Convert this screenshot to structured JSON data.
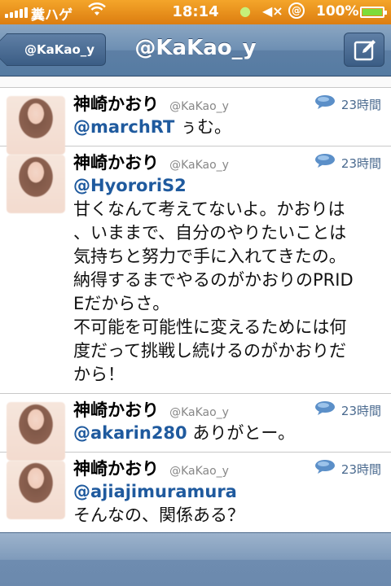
{
  "status_bar": {
    "carrier": "糞ハゲ",
    "time": "18:14",
    "battery_percent": "100%",
    "battery_level": 1.0,
    "icons": [
      "signal-icon",
      "wifi-icon",
      "chat-icon",
      "mute-icon",
      "at-sign-icon",
      "battery-icon"
    ]
  },
  "nav": {
    "back_label": "@KaKao_y",
    "title": "@KaKao_y",
    "compose_icon": "compose-icon"
  },
  "colors": {
    "status_bar": "#e88f1c",
    "nav_bar": "#6d8fb3",
    "mention": "#1f5a9e",
    "timestamp": "#4a6a8f"
  },
  "tweets": [
    {
      "name": "神崎かおり",
      "handle": "@KaKao_y",
      "time": "23時間",
      "mention": "@marchRT",
      "text": " ぅむ。"
    },
    {
      "name": "神崎かおり",
      "handle": "@KaKao_y",
      "time": "23時間",
      "mention": "@HyororiS2",
      "lines": [
        "甘くなんて考えてないよ。かおりは",
        "、いままで、自分のやりたいことは",
        "気持ちと努力で手に入れてきたの。",
        "納得するまでやるのがかおりのPRID",
        "Eだからさ。",
        "不可能を可能性に変えるためには何",
        "度だって挑戦し続けるのがかおりだ",
        "から！"
      ]
    },
    {
      "name": "神崎かおり",
      "handle": "@KaKao_y",
      "time": "23時間",
      "mention": "@akarin280",
      "text": " ありがとー。"
    },
    {
      "name": "神崎かおり",
      "handle": "@KaKao_y",
      "time": "23時間",
      "mention": "@ajiajimuramura",
      "text": "そんなの、関係ある？"
    }
  ]
}
